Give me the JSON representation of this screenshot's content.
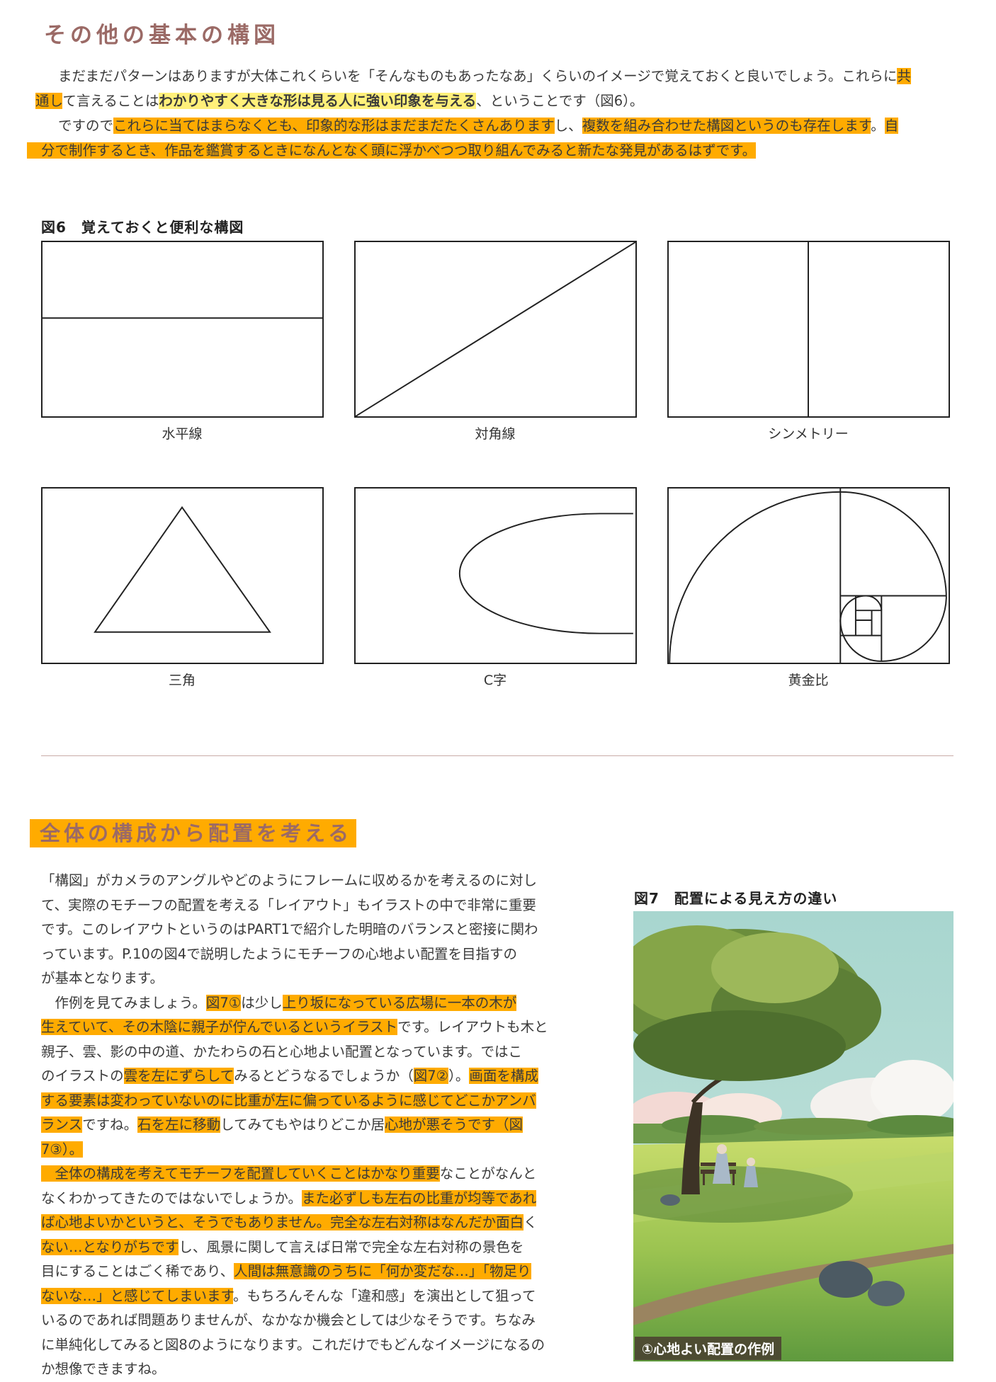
{
  "section1": {
    "heading": "その他の基本の構図",
    "p1": [
      {
        "t": "まだまだパターンはありますが大体これくらいを「そんなものもあったなあ」くらいのイメージで覚えておくと良いでしょう。これらに",
        "hl": ""
      },
      {
        "t": "共",
        "hl": "o"
      }
    ],
    "p1b": [
      {
        "t": "通し",
        "hl": "o"
      },
      {
        "t": "て言えることは",
        "hl": ""
      },
      {
        "t": "わかりやすく大きな形は",
        "hl": "y"
      },
      {
        "t": "見る人に強い印象を与える",
        "hl": "y"
      },
      {
        "t": "、ということです（図6）。",
        "hl": ""
      }
    ],
    "p2a": [
      {
        "t": "ですので",
        "hl": ""
      },
      {
        "t": "これらに当てはまらなくとも、",
        "hl": "o"
      },
      {
        "t": "印象的な形はまだまだたくさんあります",
        "hl": "o"
      },
      {
        "t": "し、",
        "hl": ""
      },
      {
        "t": "複数を組み合わせた構図というのも存在します",
        "hl": "o"
      },
      {
        "t": "。",
        "hl": ""
      },
      {
        "t": "自",
        "hl": "o"
      }
    ],
    "p2b": "分で制作するとき、作品を鑑賞するときになんとなく頭に浮かべつつ取り組んでみると新たな発見があるはずです。"
  },
  "figure6": {
    "title": "図6　覚えておくと便利な構図",
    "captions": [
      "水平線",
      "対角線",
      "シンメトリー",
      "三角",
      "C字",
      "黄金比"
    ]
  },
  "section2": {
    "heading": "全体の構成から配置を考える",
    "lines": [
      [
        {
          "t": "「構図」がカメラのアングルやどのようにフレームに収めるかを考えるのに対し",
          "hl": ""
        }
      ],
      [
        {
          "t": "て、実際のモチーフの配置を考える「レイアウト」もイラストの中で非常に重要",
          "hl": ""
        }
      ],
      [
        {
          "t": "です。このレイアウトというのはPART1で紹介した明暗のバランスと密接に関わ",
          "hl": ""
        }
      ],
      [
        {
          "t": "っています。P.10の図4で説明したようにモチーフの心地よい配置を目指すの",
          "hl": ""
        }
      ],
      [
        {
          "t": "が基本となります。",
          "hl": ""
        }
      ],
      [
        {
          "t": "　作例を見てみましょう。",
          "hl": ""
        },
        {
          "t": "図7①",
          "hl": "o"
        },
        {
          "t": "は少し",
          "hl": ""
        },
        {
          "t": "上り坂になっている広場に一本の木が",
          "hl": "o"
        }
      ],
      [
        {
          "t": "生えていて、その木陰に親子が佇んでいるというイラスト",
          "hl": "o"
        },
        {
          "t": "です。レイアウトも木と",
          "hl": ""
        }
      ],
      [
        {
          "t": "親子、雲、影の中の道、かたわらの石と心地よい配置となっています。ではこ",
          "hl": ""
        }
      ],
      [
        {
          "t": "のイラストの",
          "hl": ""
        },
        {
          "t": "雲を左にずらして",
          "hl": "o"
        },
        {
          "t": "みるとどうなるでしょうか（",
          "hl": ""
        },
        {
          "t": "図7②",
          "hl": "o"
        },
        {
          "t": "）。",
          "hl": ""
        },
        {
          "t": "画面を構成",
          "hl": "o"
        }
      ],
      [
        {
          "t": "する要素は変わっていないのに比重が左に偏っているように感じてどこかアンバ",
          "hl": "o"
        }
      ],
      [
        {
          "t": "ランス",
          "hl": "o"
        },
        {
          "t": "ですね。",
          "hl": ""
        },
        {
          "t": "石を左に移動",
          "hl": "o"
        },
        {
          "t": "してみてもやはりどこか居",
          "hl": ""
        },
        {
          "t": "心地が悪そうです（図",
          "hl": "o"
        }
      ],
      [
        {
          "t": "7③）。",
          "hl": "o"
        }
      ],
      [
        {
          "t": "　全体の構成を考えてモチーフを配置していくことはかなり重要",
          "hl": "o"
        },
        {
          "t": "なことがなんと",
          "hl": ""
        }
      ],
      [
        {
          "t": "なくわかってきたのではないでしょうか。",
          "hl": ""
        },
        {
          "t": "また必ずしも左右の比重が均等であれ",
          "hl": "o"
        }
      ],
      [
        {
          "t": "ば心地よいかというと、そうでもありません。",
          "hl": "o"
        },
        {
          "t": "完全な左右対称はなんだか面白",
          "hl": "o"
        },
        {
          "t": "く",
          "hl": ""
        }
      ],
      [
        {
          "t": "ない…となりがちです",
          "hl": "o"
        },
        {
          "t": "し、風景に関して言えば日常で完全な左右対称の景色を",
          "hl": ""
        }
      ],
      [
        {
          "t": "目にすることはごく稀であり、",
          "hl": ""
        },
        {
          "t": "人間は無意識のうちに「何か変だな…」「物足り",
          "hl": "o"
        }
      ],
      [
        {
          "t": "ないな…」と感じてしまいます",
          "hl": "o"
        },
        {
          "t": "。もちろんそんな「違和感」を演出として狙って",
          "hl": ""
        }
      ],
      [
        {
          "t": "いるのであれば問題ありませんが、なかなか機会としては少なそうです。ちなみ",
          "hl": ""
        }
      ],
      [
        {
          "t": "に単純化してみると図8のようになります。これだけでもどんなイメージになるの",
          "hl": ""
        }
      ],
      [
        {
          "t": "か想像できますね。",
          "hl": ""
        }
      ]
    ]
  },
  "figure7": {
    "title": "図7　配置による見え方の違い",
    "caption": "①心地よい配置の作例"
  },
  "colors": {
    "heading": "#9b6a66",
    "highlight": "#ffab00",
    "highlight_yellow": "#fff07a"
  }
}
